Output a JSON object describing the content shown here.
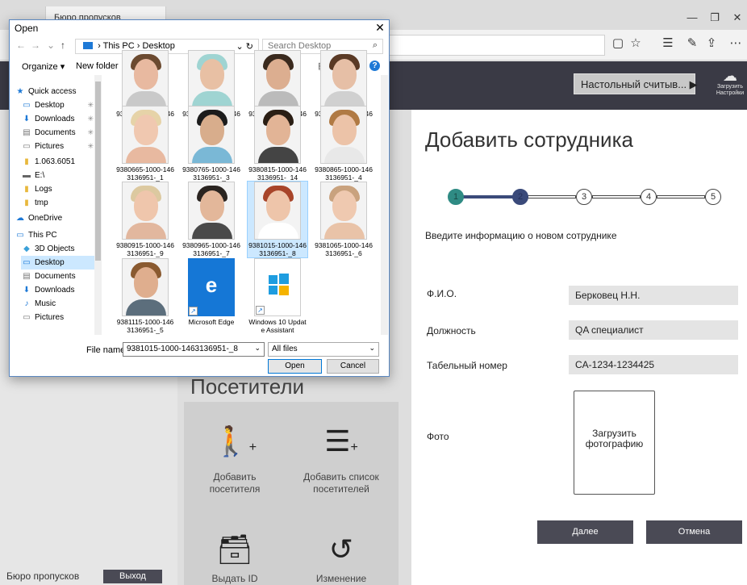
{
  "browser": {
    "tab_title": "Бюро пропусков",
    "win_minimize": "—",
    "win_restore": "❐",
    "win_close": "✕",
    "toolbar_icons": [
      "reading-view",
      "favorite-star",
      "favorites",
      "pen",
      "share",
      "more"
    ]
  },
  "app": {
    "reader_button": "Настольный считыв... ▶",
    "upload_label": "Загрузить Настройки",
    "visitors_title": "Посетители",
    "visitors_tiles": [
      {
        "label": "Добавить посетителя",
        "icon": "add-visitor"
      },
      {
        "label": "Добавить список посетителей",
        "icon": "add-visitor-list"
      },
      {
        "label": "Выдать ID",
        "icon": "issue-id"
      },
      {
        "label": "Изменение",
        "icon": "history-24"
      }
    ],
    "footer_bureau": "Бюро пропусков",
    "exit_button": "Выход"
  },
  "add_employee": {
    "title": "Добавить сотрудника",
    "steps": [
      "1",
      "2",
      "3",
      "4",
      "5"
    ],
    "current_step": 2,
    "subtitle": "Введите информацию о новом сотруднике",
    "fields": [
      {
        "label": "Ф.И.О.",
        "value": "Берковец Н.Н."
      },
      {
        "label": "Должность",
        "value": "QA специалист"
      },
      {
        "label": "Табельный номер",
        "value": "CA-1234-1234425"
      },
      {
        "label": "Фото",
        "value": ""
      }
    ],
    "photo_button": "Загрузить фотографию",
    "next_button": "Далее",
    "cancel_button": "Отмена"
  },
  "open_dialog": {
    "title": "Open",
    "path": [
      "This PC",
      "Desktop"
    ],
    "search_placeholder": "Search Desktop",
    "organize": "Organize ▾",
    "new_folder": "New folder",
    "nav_items": [
      {
        "label": "Quick access",
        "icon": "star"
      },
      {
        "label": "Desktop",
        "icon": "desktop",
        "pinned": true
      },
      {
        "label": "Downloads",
        "icon": "downloads",
        "pinned": true
      },
      {
        "label": "Documents",
        "icon": "documents",
        "pinned": true
      },
      {
        "label": "Pictures",
        "icon": "pictures",
        "pinned": true
      },
      {
        "label": "1.063.6051",
        "icon": "folder"
      },
      {
        "label": "E:\\",
        "icon": "drive"
      },
      {
        "label": "Logs",
        "icon": "folder"
      },
      {
        "label": "tmp",
        "icon": "folder"
      },
      {
        "label": "OneDrive",
        "icon": "cloud"
      },
      {
        "label": "This PC",
        "icon": "pc"
      },
      {
        "label": "3D Objects",
        "icon": "objects"
      },
      {
        "label": "Desktop",
        "icon": "desktop",
        "selected": true
      },
      {
        "label": "Documents",
        "icon": "documents"
      },
      {
        "label": "Downloads",
        "icon": "downloads"
      },
      {
        "label": "Music",
        "icon": "music"
      },
      {
        "label": "Pictures",
        "icon": "pictures"
      }
    ],
    "files": [
      {
        "name": "9380465-1000-1463136951-_13",
        "kind": "photo",
        "skin": "#e8b9a0",
        "hair": "#6b4a30",
        "shirt": "#c9c9c9"
      },
      {
        "name": "9380515-1000-1463136951-_15",
        "kind": "photo",
        "skin": "#e8c0a4",
        "hair": "#9fd4d2",
        "shirt": "#9fd4d2"
      },
      {
        "name": "9380565-1000-1463136951-_12",
        "kind": "photo",
        "skin": "#dcae90",
        "hair": "#3a2a1e",
        "shirt": "#bbbbbb"
      },
      {
        "name": "9380615-1000-1463136951-_11",
        "kind": "photo",
        "skin": "#e6bfa6",
        "hair": "#5a3a25",
        "shirt": "#d0d0d0"
      },
      {
        "name": "9380665-1000-1463136951-_1",
        "kind": "photo",
        "skin": "#f0c8b0",
        "hair": "#e6d3a8",
        "shirt": "#e8b9a0"
      },
      {
        "name": "9380765-1000-1463136951-_3",
        "kind": "photo",
        "skin": "#d8ad8c",
        "hair": "#1c1c1c",
        "shirt": "#7ab8d6"
      },
      {
        "name": "9380815-1000-1463136951-_14",
        "kind": "photo",
        "skin": "#e2b496",
        "hair": "#2a1e14",
        "shirt": "#444444"
      },
      {
        "name": "9380865-1000-1463136951-_4",
        "kind": "photo",
        "skin": "#ecc3a8",
        "hair": "#b07a44",
        "shirt": "#e8e8e8"
      },
      {
        "name": "9380915-1000-1463136951-_9",
        "kind": "photo",
        "skin": "#efc6ac",
        "hair": "#dcc9a0",
        "shirt": "#e2b79e"
      },
      {
        "name": "9380965-1000-1463136951-_7",
        "kind": "photo",
        "skin": "#e3b79a",
        "hair": "#2a2420",
        "shirt": "#4a4a4a"
      },
      {
        "name": "9381015-1000-1463136951-_8",
        "kind": "photo",
        "skin": "#eec5aa",
        "hair": "#a8452a",
        "shirt": "#ffffff",
        "selected": true
      },
      {
        "name": "9381065-1000-1463136951-_6",
        "kind": "photo",
        "skin": "#efc9b0",
        "hair": "#c9a27e",
        "shirt": "#e9c3a8"
      },
      {
        "name": "9381115-1000-1463136951-_5",
        "kind": "photo",
        "skin": "#dfae8e",
        "hair": "#8a5a30",
        "shirt": "#5c6e7c"
      },
      {
        "name": "Microsoft Edge",
        "kind": "edge"
      },
      {
        "name": "Windows 10 Update Assistant",
        "kind": "windows"
      }
    ],
    "file_name_label": "File name:",
    "file_name_value": "9381015-1000-1463136951-_8",
    "file_type": "All files",
    "open_button": "Open",
    "cancel_button": "Cancel"
  }
}
